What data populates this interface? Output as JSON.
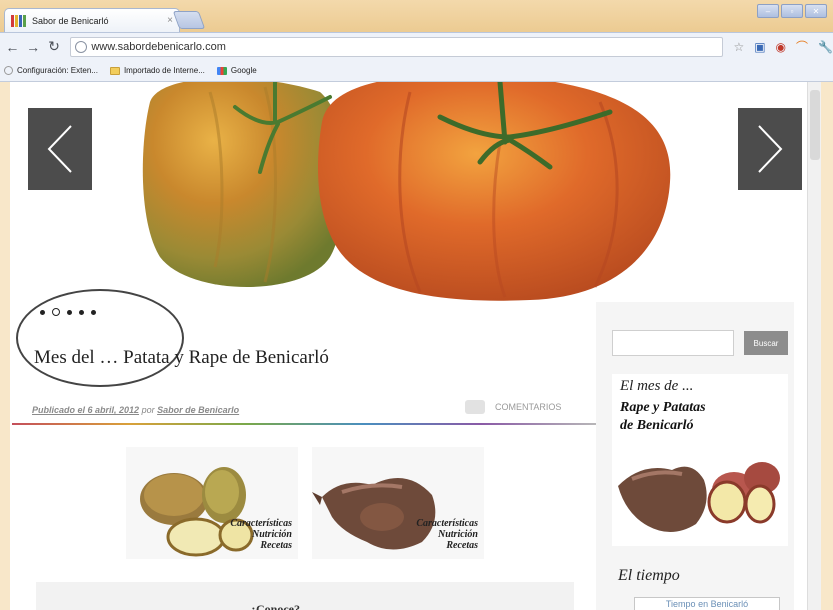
{
  "browser": {
    "tab_title": "Sabor de Benicarló",
    "tab_close": "×",
    "url": "www.sabordebenicarlo.com",
    "bookmarks": [
      {
        "label": "Configuración: Exten...",
        "icon": "settings-icon"
      },
      {
        "label": "Importado de Interne...",
        "icon": "folder-icon"
      },
      {
        "label": "Google",
        "icon": "google-icon"
      }
    ]
  },
  "slider": {
    "prev_icon": "chevron-left-icon",
    "next_icon": "chevron-right-icon",
    "dots_count": 5,
    "active_dot": 2
  },
  "post": {
    "title": "Mes del … Patata y Rape de Benicarló",
    "published_label": "Publicado el 6 abril, 2012",
    "by": "por",
    "author": "Sabor de Benicarlo",
    "comments_label": "COMENTARIOS"
  },
  "cards": [
    {
      "lines": [
        "Características",
        "Nutrición",
        "Recetas"
      ],
      "image": "potatoes"
    },
    {
      "lines": [
        "Características",
        "Nutrición",
        "Recetas"
      ],
      "image": "monkfish"
    }
  ],
  "bottom_banner_text": "¿Conoce?",
  "sidebar": {
    "search_button": "Buscar",
    "promo_line1": "El mes de ...",
    "promo_line2": "Rape y Patatas",
    "promo_line3": "de Benicarló",
    "tiempo_title": "El tiempo",
    "tiempo_link": "Tiempo en Benicarló"
  },
  "colors": {
    "accent_dark": "#4c4c4c",
    "chrome_frame": "#f8e7c9"
  }
}
